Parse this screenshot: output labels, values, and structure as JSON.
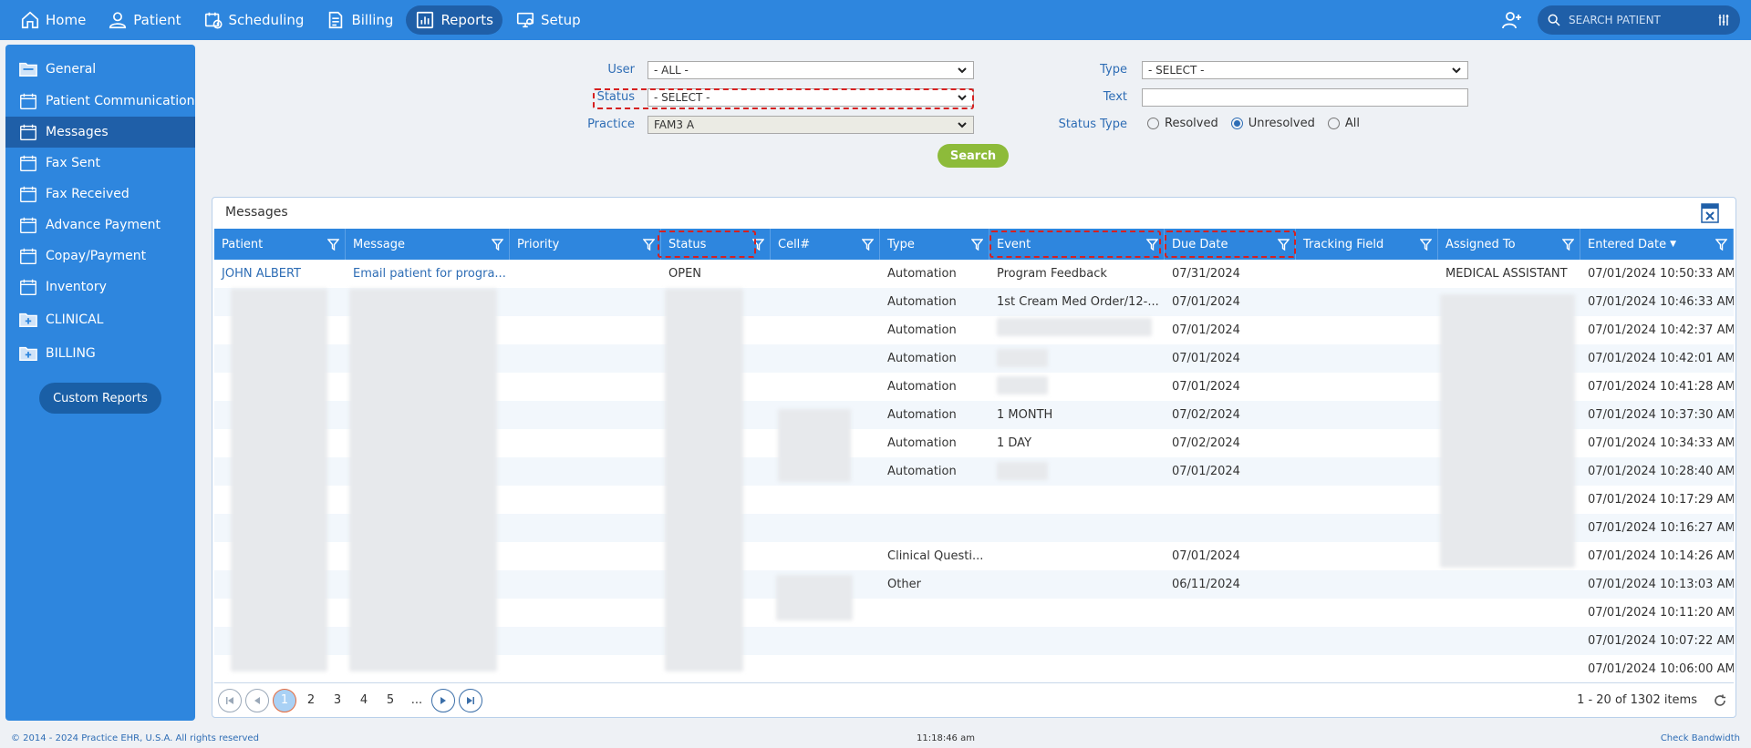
{
  "nav": {
    "items": [
      {
        "label": "Home",
        "icon": "home-icon"
      },
      {
        "label": "Patient",
        "icon": "person-icon"
      },
      {
        "label": "Scheduling",
        "icon": "calendar-clock-icon"
      },
      {
        "label": "Billing",
        "icon": "document-icon"
      },
      {
        "label": "Reports",
        "icon": "chart-icon",
        "active": true
      },
      {
        "label": "Setup",
        "icon": "monitor-settings-icon"
      }
    ],
    "search_placeholder": "SEARCH PATIENT"
  },
  "sidebar": {
    "items": [
      {
        "label": "General",
        "type": "folder-open"
      },
      {
        "label": "Patient Communication",
        "type": "calendar"
      },
      {
        "label": "Messages",
        "type": "calendar",
        "active": true
      },
      {
        "label": "Fax Sent",
        "type": "calendar"
      },
      {
        "label": "Fax Received",
        "type": "calendar"
      },
      {
        "label": "Advance Payment",
        "type": "calendar"
      },
      {
        "label": "Copay/Payment",
        "type": "calendar"
      },
      {
        "label": "Inventory",
        "type": "calendar"
      },
      {
        "label": "CLINICAL",
        "type": "folder-plus"
      },
      {
        "label": "BILLING",
        "type": "folder-plus"
      }
    ],
    "custom_reports": "Custom Reports"
  },
  "filters": {
    "user_label": "User",
    "user_value": "- ALL -",
    "status_label": "Status",
    "status_value": "- SELECT -",
    "practice_label": "Practice",
    "practice_value": "FAM3 A",
    "type_label": "Type",
    "type_value": "- SELECT -",
    "text_label": "Text",
    "text_value": "",
    "status_type_label": "Status Type",
    "status_type_options": [
      "Resolved",
      "Unresolved",
      "All"
    ],
    "status_type_selected": "Unresolved",
    "search_button": "Search"
  },
  "grid": {
    "title": "Messages",
    "columns": [
      "Patient",
      "Message",
      "Priority",
      "Status",
      "Cell#",
      "Type",
      "Event",
      "Due Date",
      "Tracking Field",
      "Assigned To",
      "Entered Date"
    ],
    "rows": [
      [
        "JOHN ALBERT",
        "Email patient for progra...",
        "",
        "OPEN",
        "",
        "Automation",
        "Program Feedback",
        "07/31/2024",
        "",
        "MEDICAL ASSISTANT",
        "07/01/2024 10:50:33 AM"
      ],
      [
        "",
        "",
        "",
        "",
        "",
        "Automation",
        "1st Cream Med Order/12-...",
        "07/01/2024",
        "",
        "",
        "07/01/2024 10:46:33 AM"
      ],
      [
        "",
        "",
        "",
        "",
        "",
        "Automation",
        "",
        "07/01/2024",
        "",
        "",
        "07/01/2024 10:42:37 AM"
      ],
      [
        "",
        "",
        "",
        "",
        "",
        "Automation",
        "",
        "07/01/2024",
        "",
        "",
        "07/01/2024 10:42:01 AM"
      ],
      [
        "",
        "",
        "",
        "",
        "",
        "Automation",
        "",
        "07/01/2024",
        "",
        "",
        "07/01/2024 10:41:28 AM"
      ],
      [
        "",
        "",
        "",
        "",
        "",
        "Automation",
        "1 MONTH",
        "07/02/2024",
        "",
        "",
        "07/01/2024 10:37:30 AM"
      ],
      [
        "",
        "",
        "",
        "",
        "",
        "Automation",
        "1 DAY",
        "07/02/2024",
        "",
        "",
        "07/01/2024 10:34:33 AM"
      ],
      [
        "",
        "",
        "",
        "",
        "",
        "Automation",
        "",
        "07/01/2024",
        "",
        "",
        "07/01/2024 10:28:40 AM"
      ],
      [
        "",
        "",
        "",
        "",
        "",
        "",
        "",
        "",
        "",
        "",
        "07/01/2024 10:17:29 AM"
      ],
      [
        "",
        "",
        "",
        "",
        "",
        "",
        "",
        "",
        "",
        "",
        "07/01/2024 10:16:27 AM"
      ],
      [
        "",
        "",
        "",
        "",
        "",
        "Clinical Questi...",
        "",
        "07/01/2024",
        "",
        "",
        "07/01/2024 10:14:26 AM"
      ],
      [
        "",
        "",
        "",
        "",
        "",
        "Other",
        "",
        "06/11/2024",
        "",
        "",
        "07/01/2024 10:13:03 AM"
      ],
      [
        "",
        "",
        "",
        "",
        "",
        "",
        "",
        "",
        "",
        "",
        "07/01/2024 10:11:20 AM"
      ],
      [
        "",
        "",
        "",
        "",
        "",
        "",
        "",
        "",
        "",
        "",
        "07/01/2024 10:07:22 AM"
      ],
      [
        "",
        "",
        "",
        "",
        "",
        "",
        "",
        "",
        "",
        "",
        "07/01/2024 10:06:00 AM"
      ]
    ]
  },
  "pager": {
    "pages": [
      "1",
      "2",
      "3",
      "4",
      "5",
      "..."
    ],
    "current": "1",
    "info": "1 - 20 of 1302 items"
  },
  "footer": {
    "copyright": "© 2014 - 2024 Practice EHR, U.S.A. All rights reserved",
    "time": "11:18:46 am",
    "bandwidth": "Check Bandwidth"
  },
  "colors": {
    "primary": "#2e86de",
    "primary_dark": "#1f5fa8",
    "search_button": "#8dbb3a",
    "highlight": "#d62020"
  }
}
